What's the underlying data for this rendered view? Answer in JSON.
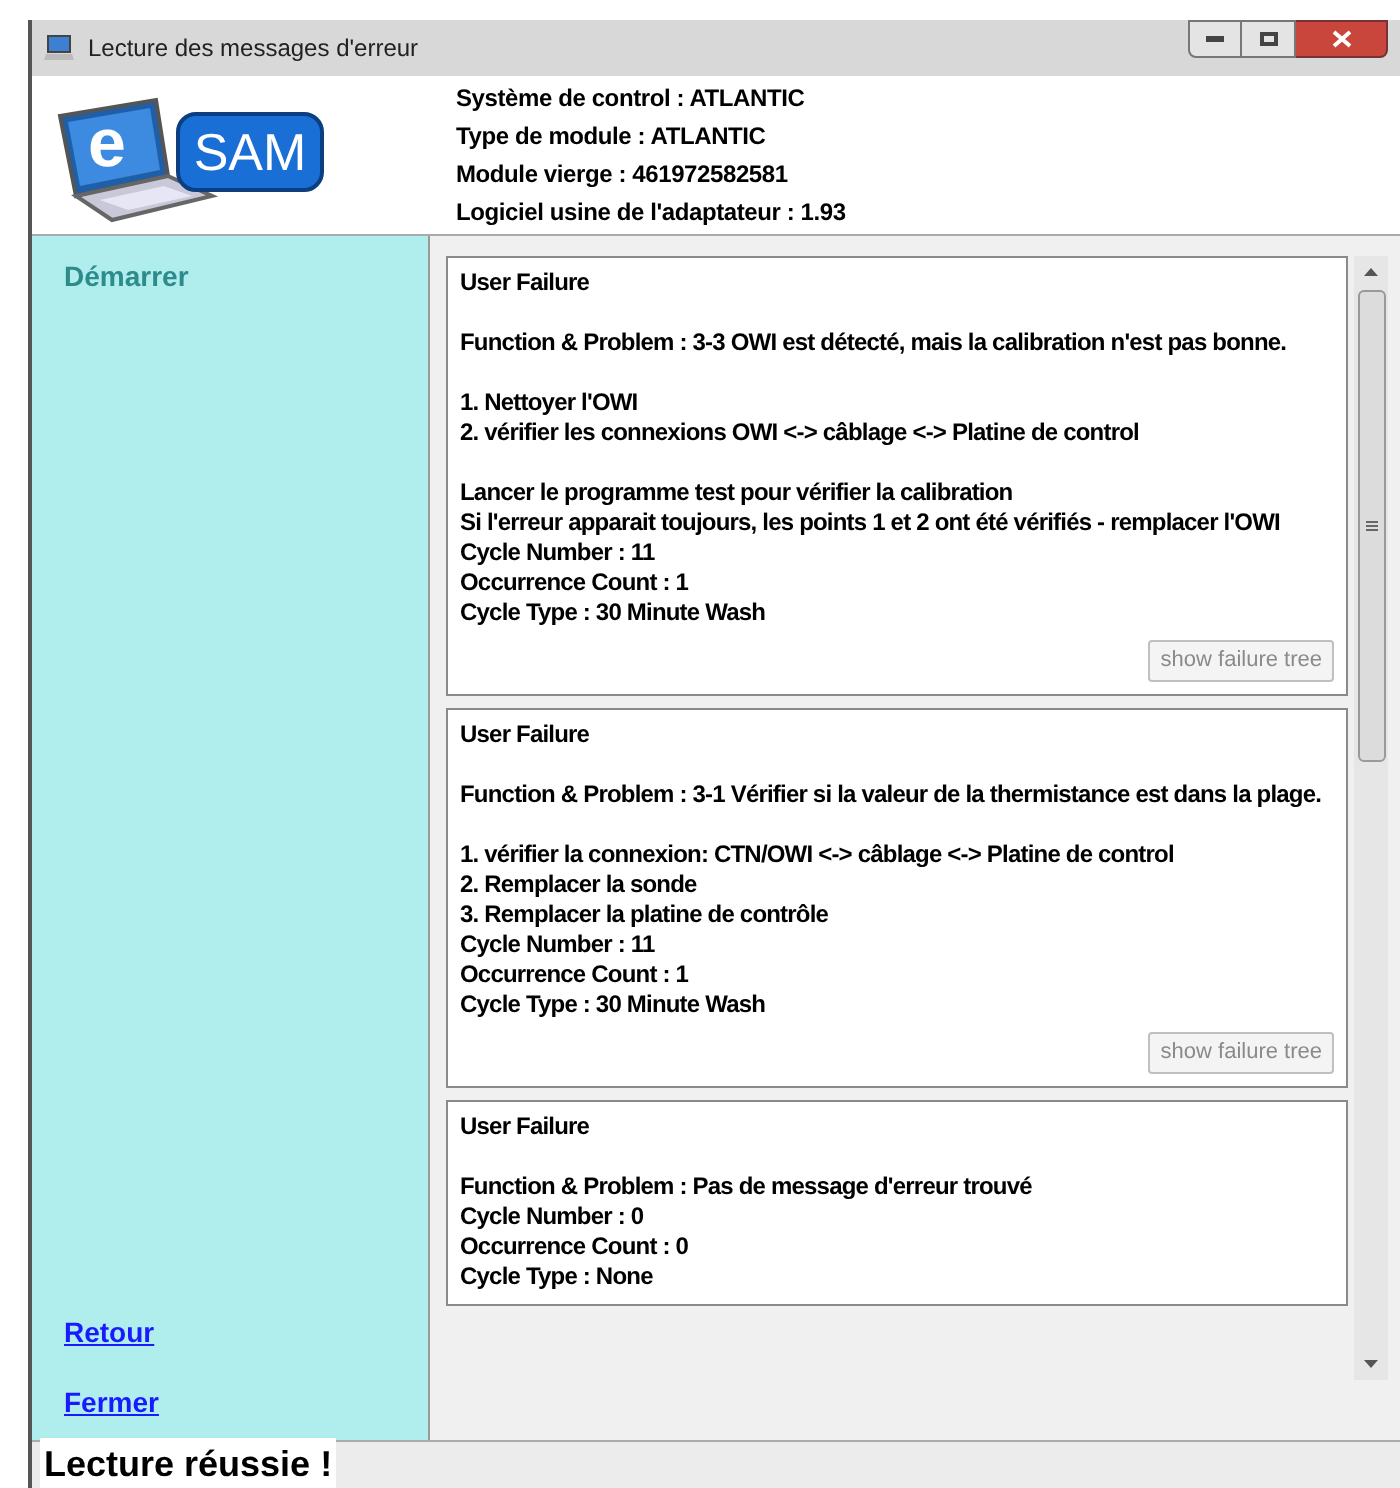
{
  "window": {
    "title": "Lecture des messages d'erreur"
  },
  "logo": {
    "letter": "e",
    "text": "SAM"
  },
  "info": [
    "Système de control : ATLANTIC",
    "Type de module : ATLANTIC",
    "Module vierge : 461972582581",
    "Logiciel usine de l'adaptateur : 1.93"
  ],
  "sidebar": {
    "heading": "Démarrer",
    "links": [
      "Retour",
      "Fermer"
    ]
  },
  "failures": [
    {
      "title": "User Failure",
      "paragraphs": [
        [
          "Function & Problem : 3-3 OWI est détecté, mais la calibration n'est pas bonne."
        ],
        [
          "1. Nettoyer l'OWI",
          "2. vérifier les connexions OWI <-> câblage <-> Platine de control"
        ],
        [
          "Lancer le programme test pour vérifier la calibration",
          "Si l'erreur apparait toujours, les points 1 et 2 ont été vérifiés - remplacer l'OWI",
          "Cycle Number : 11",
          "Occurrence Count : 1",
          "Cycle Type : 30 Minute Wash"
        ]
      ],
      "button": "show failure tree"
    },
    {
      "title": "User Failure",
      "paragraphs": [
        [
          "Function & Problem : 3-1 Vérifier si la valeur de la thermistance est dans la plage."
        ],
        [
          "1. vérifier la connexion: CTN/OWI <-> câblage <-> Platine de control",
          "2. Remplacer la sonde",
          "3. Remplacer la platine de contrôle",
          "Cycle Number : 11",
          "Occurrence Count : 1",
          "Cycle Type : 30 Minute Wash"
        ]
      ],
      "button": "show failure tree"
    },
    {
      "title": "User Failure",
      "paragraphs": [
        [
          "Function & Problem : Pas de message d'erreur trouvé",
          "Cycle Number : 0",
          "Occurrence Count : 0",
          "Cycle Type : None"
        ]
      ]
    }
  ],
  "status_bar": "Lecture réussie !"
}
